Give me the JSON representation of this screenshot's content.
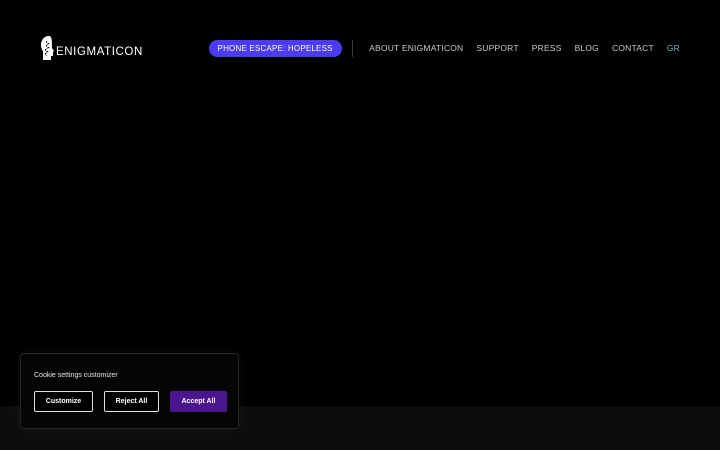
{
  "brand": {
    "name": "ENIGMATICON",
    "logo_icon": "head-profile-logo"
  },
  "nav": {
    "cta_label": "PHONE ESCAPE: HOPELESS",
    "items": [
      {
        "label": "ABOUT ENIGMATICON"
      },
      {
        "label": "SUPPORT"
      },
      {
        "label": "PRESS"
      },
      {
        "label": "BLOG"
      },
      {
        "label": "CONTACT"
      }
    ],
    "language": "GR"
  },
  "cookie_banner": {
    "title": "Cookie settings customizer",
    "customize_label": "Customize",
    "reject_label": "Reject All",
    "accept_label": "Accept All"
  },
  "colors": {
    "background": "#000000",
    "cta": "#4a3cf2",
    "accept_button": "#4b1590",
    "language_link": "#5fc2b5"
  }
}
